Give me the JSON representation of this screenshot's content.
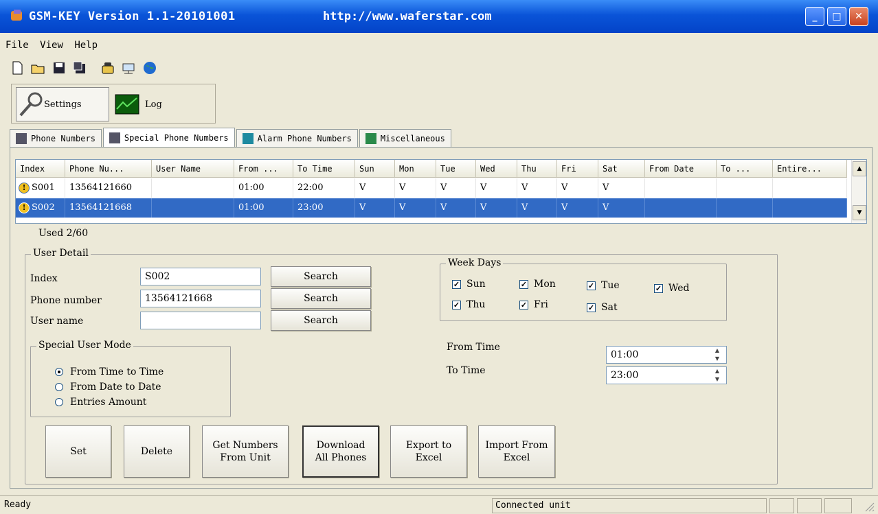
{
  "window": {
    "title": "GSM-KEY Version 1.1-20101001",
    "url": "http://www.waferstar.com"
  },
  "menu": {
    "file": "File",
    "view": "View",
    "help": "Help"
  },
  "views": {
    "settings": "Settings",
    "log": "Log"
  },
  "tabs": [
    "Phone Numbers",
    "Special Phone Numbers",
    "Alarm Phone Numbers",
    "Miscellaneous"
  ],
  "table": {
    "headers": [
      "Index",
      "Phone Nu...",
      "User Name",
      "From ...",
      "To Time",
      "Sun",
      "Mon",
      "Tue",
      "Wed",
      "Thu",
      "Fri",
      "Sat",
      "From Date",
      "To ...",
      "Entire..."
    ],
    "rows": [
      [
        "S001",
        "13564121660",
        "",
        "01:00",
        "22:00",
        "V",
        "V",
        "V",
        "V",
        "V",
        "V",
        "V",
        "",
        "",
        ""
      ],
      [
        "S002",
        "13564121668",
        "",
        "01:00",
        "23:00",
        "V",
        "V",
        "V",
        "V",
        "V",
        "V",
        "V",
        "",
        "",
        ""
      ]
    ],
    "selected_row": 1
  },
  "used": "Used 2/60",
  "user_detail": {
    "title": "User Detail",
    "index_label": "Index",
    "index_value": "S002",
    "phone_label": "Phone number",
    "phone_value": "13564121668",
    "user_label": "User name",
    "user_value": "",
    "search": "Search"
  },
  "mode": {
    "title": "Special User Mode",
    "options": [
      "From Time to Time",
      "From Date to Date",
      "Entries Amount"
    ],
    "selected": 0
  },
  "weekdays": {
    "title": "Week Days",
    "sun": "Sun",
    "mon": "Mon",
    "tue": "Tue",
    "wed": "Wed",
    "thu": "Thu",
    "fri": "Fri",
    "sat": "Sat"
  },
  "time": {
    "from_label": "From Time",
    "from_value": "01:00",
    "to_label": "To Time",
    "to_value": "23:00"
  },
  "buttons": {
    "set": "Set",
    "delete": "Delete",
    "get1": "Get Numbers",
    "get2": "From Unit",
    "dl1": "Download",
    "dl2": "All Phones",
    "ex1": "Export to",
    "ex2": "Excel",
    "im1": "Import From",
    "im2": "Excel"
  },
  "status": {
    "left": "Ready",
    "connection": "Connected unit"
  }
}
